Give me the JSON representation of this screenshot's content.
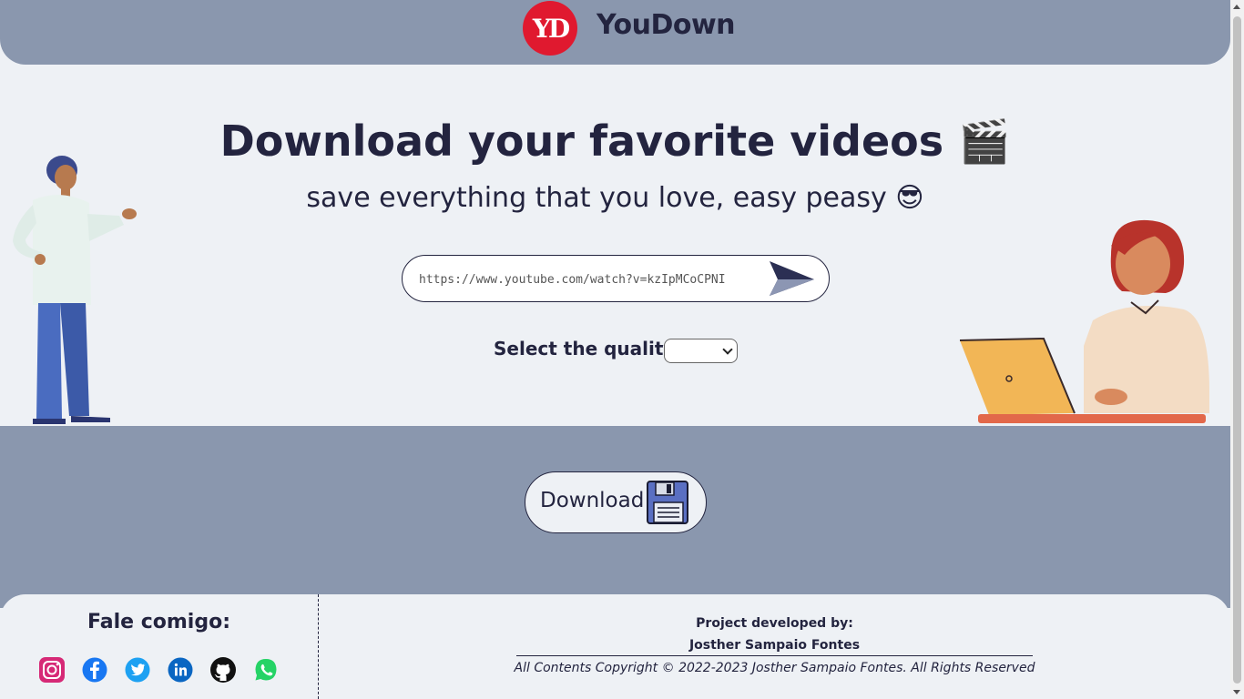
{
  "header": {
    "logo_text": "YD",
    "brand": "YouDown",
    "bg_color": "#8a97ae",
    "logo_color": "#e0192f"
  },
  "hero": {
    "title": "Download your favorite videos 🎬",
    "subtitle": "save everything that you love, easy peasy 😎"
  },
  "search": {
    "value": "https://www.youtube.com/watch?v=kzIpMCoCPNI",
    "send_icon": "paper-plane-icon"
  },
  "quality": {
    "label": "Select the quality:",
    "selected": ""
  },
  "download": {
    "label": "Download",
    "icon": "floppy-disk-icon"
  },
  "footer": {
    "contact_title": "Fale comigo:",
    "socials": [
      {
        "name": "instagram-icon",
        "color": "#d62976"
      },
      {
        "name": "facebook-icon",
        "color": "#1877f2"
      },
      {
        "name": "twitter-icon",
        "color": "#1da1f2"
      },
      {
        "name": "linkedin-icon",
        "color": "#0a66c2"
      },
      {
        "name": "github-icon",
        "color": "#111111"
      },
      {
        "name": "whatsapp-icon",
        "color": "#25d366"
      }
    ],
    "dev_label": "Project developed by:",
    "dev_name": "Josther Sampaio Fontes",
    "copyright": "All Contents Copyright © 2022-2023 Josther Sampaio Fontes. All Rights Reserved"
  }
}
